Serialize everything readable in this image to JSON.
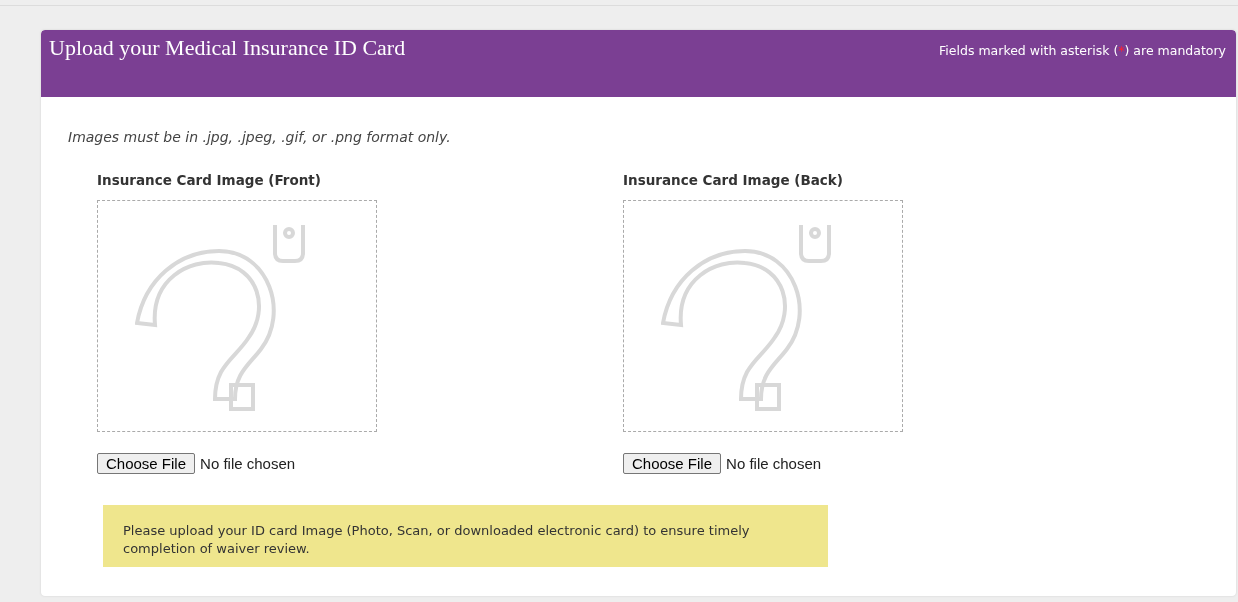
{
  "header": {
    "title": "Upload your Medical Insurance ID Card",
    "mandatory_note": {
      "before": "Fields marked with asterisk (",
      "asterisk": "*",
      "after": ") are mandatory"
    }
  },
  "format_note": "Images must be in .jpg, .jpeg, .gif, or .png format only.",
  "uploads": [
    {
      "label": "Insurance Card Image (Front)",
      "button": "Choose File",
      "status": "No file chosen"
    },
    {
      "label": "Insurance Card Image (Back)",
      "button": "Choose File",
      "status": "No file chosen"
    }
  ],
  "notice": "Please upload your ID card Image (Photo, Scan, or downloaded electronic card) to ensure timely completion of waiver review."
}
